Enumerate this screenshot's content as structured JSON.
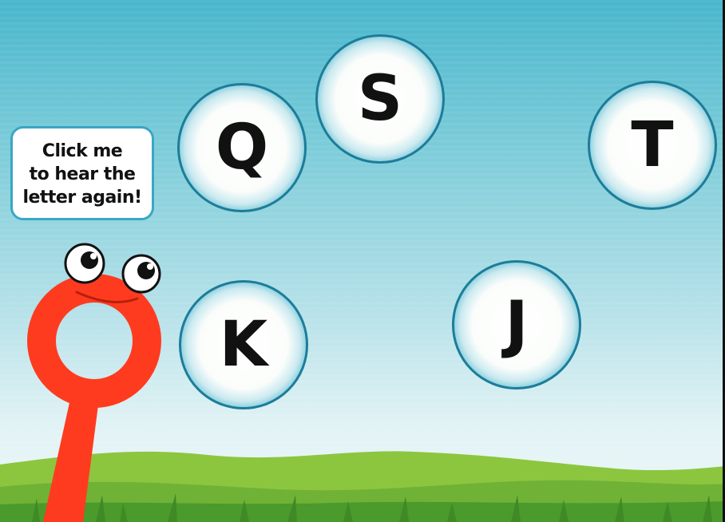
{
  "game": {
    "hint_text_lines": [
      "Click me",
      "to hear the",
      "letter again!"
    ],
    "letters": [
      "Q",
      "S",
      "T",
      "K",
      "J"
    ]
  },
  "colors": {
    "sky_top": "#48b6cc",
    "sky_bottom": "#eef8f8",
    "bubble_rim": "#1b88a7",
    "mascot_red": "#ff3b1f",
    "hill_green": "#8cc63f",
    "grass_green": "#4a9a2c",
    "speech_border": "#3aa7c4"
  },
  "icons": {
    "mascot": "magnifying-glass-character-icon"
  }
}
